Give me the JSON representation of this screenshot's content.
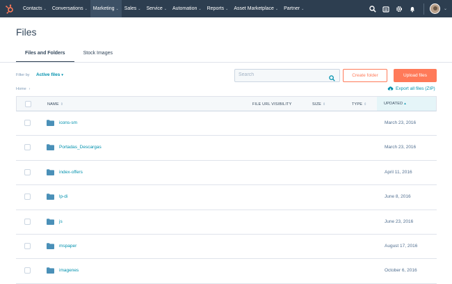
{
  "nav": {
    "items": [
      {
        "label": "Contacts",
        "active": false
      },
      {
        "label": "Conversations",
        "active": false
      },
      {
        "label": "Marketing",
        "active": true
      },
      {
        "label": "Sales",
        "active": false
      },
      {
        "label": "Service",
        "active": false
      },
      {
        "label": "Automation",
        "active": false
      },
      {
        "label": "Reports",
        "active": false
      },
      {
        "label": "Asset Marketplace",
        "active": false
      },
      {
        "label": "Partner",
        "active": false
      }
    ],
    "caret": "⌄",
    "brand_color": "#ff7a59",
    "bg_color": "#2d3e50"
  },
  "page": {
    "title": "Files"
  },
  "tabs": [
    {
      "label": "Files and Folders",
      "active": true
    },
    {
      "label": "Stock Images",
      "active": false
    }
  ],
  "filter": {
    "label": "Filter by",
    "value": "Active files"
  },
  "search": {
    "placeholder": "Search",
    "value": ""
  },
  "actions": {
    "create_folder": "Create folder",
    "upload_files": "Upload files",
    "export_all": "Export all files (ZIP)"
  },
  "breadcrumb": {
    "home": "Home",
    "separator": "›"
  },
  "table": {
    "headers": {
      "name": "NAME",
      "visibility": "FILE URL VISIBILITY",
      "size": "SIZE",
      "type": "TYPE",
      "updated": "UPDATED"
    },
    "rows": [
      {
        "name": "icons-sm",
        "updated": "March 23, 2016"
      },
      {
        "name": "Portadas_Descargas",
        "updated": "March 23, 2016"
      },
      {
        "name": "index-offers",
        "updated": "April 11, 2016"
      },
      {
        "name": "lp-di",
        "updated": "June 8, 2016"
      },
      {
        "name": "js",
        "updated": "June 23, 2016"
      },
      {
        "name": "mspaper",
        "updated": "August 17, 2016"
      },
      {
        "name": "imagenes",
        "updated": "October 6, 2016"
      }
    ]
  }
}
